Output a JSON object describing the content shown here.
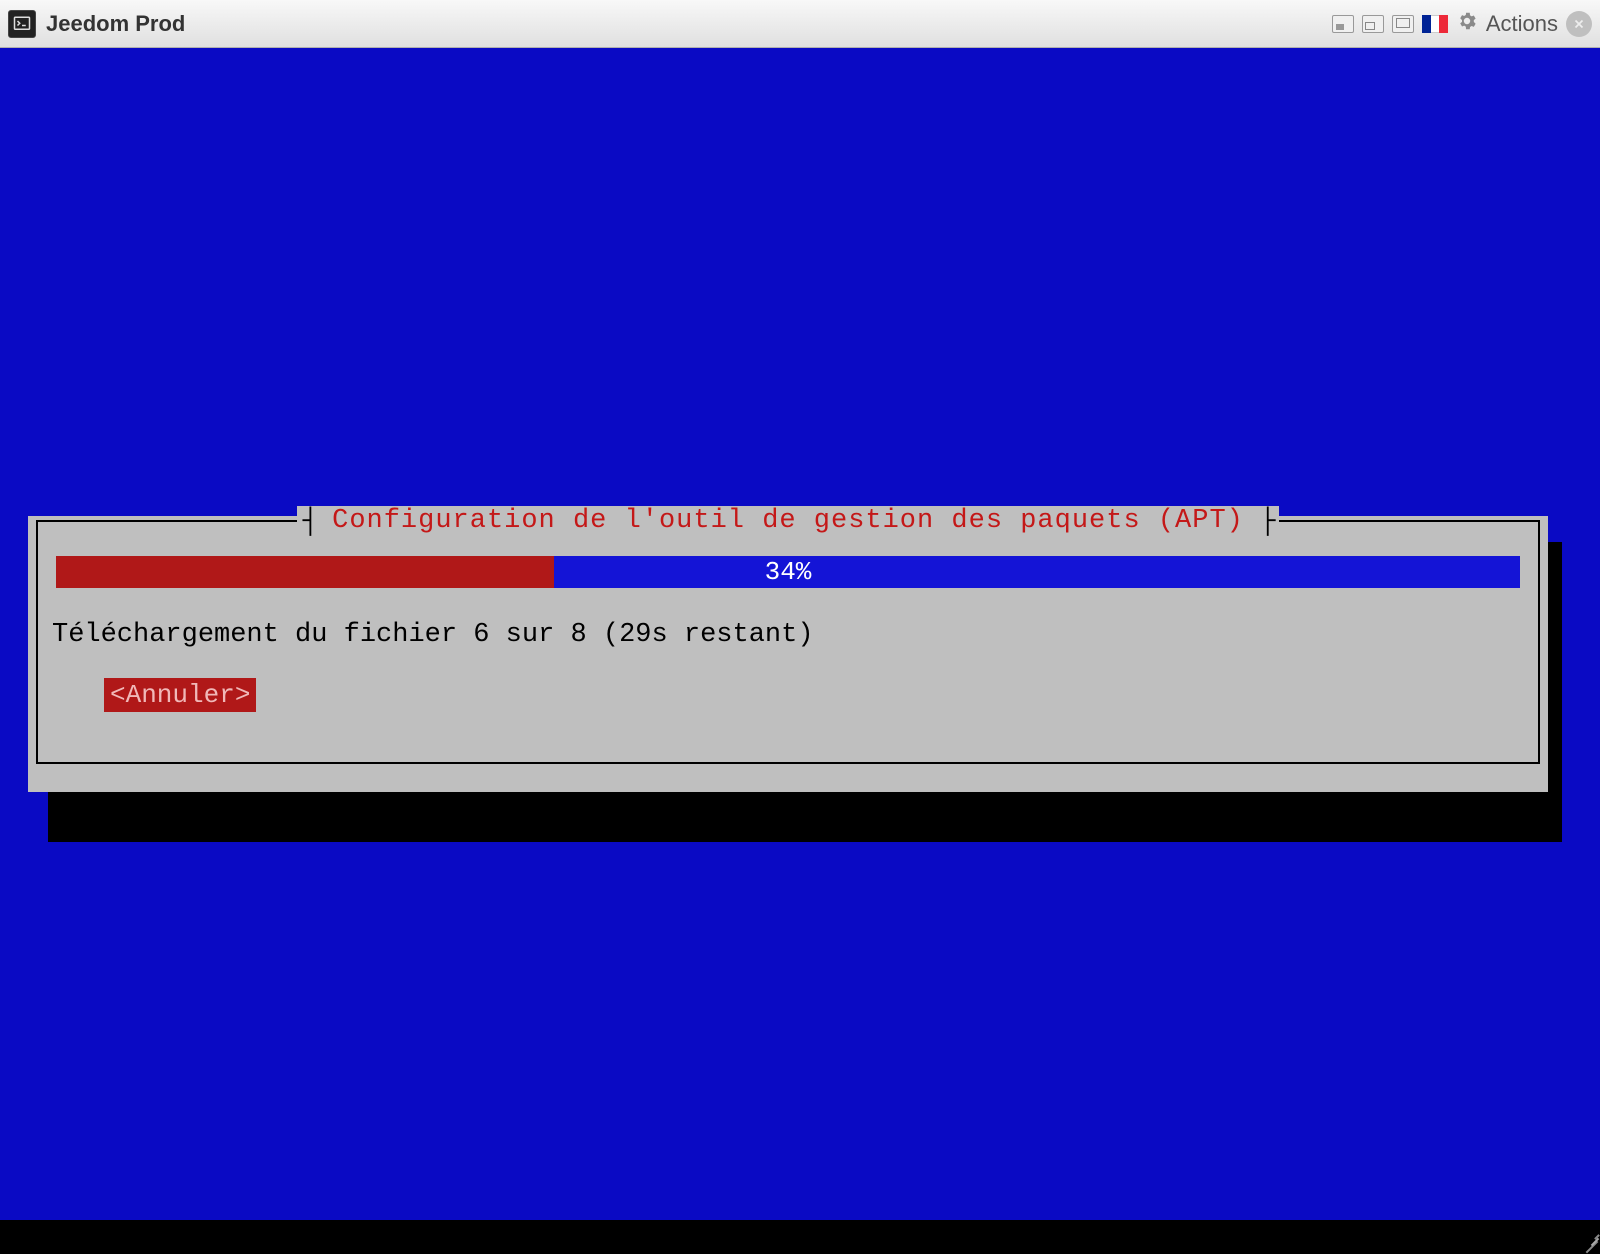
{
  "titlebar": {
    "app_title": "Jeedom Prod",
    "actions_label": "Actions"
  },
  "dialog": {
    "title": "Configuration de l'outil de gestion des paquets (APT)",
    "progress_percent": 34,
    "progress_label": "34%",
    "status": "Téléchargement du fichier 6 sur 8 (29s restant)",
    "cancel_label": "<Annuler>"
  }
}
